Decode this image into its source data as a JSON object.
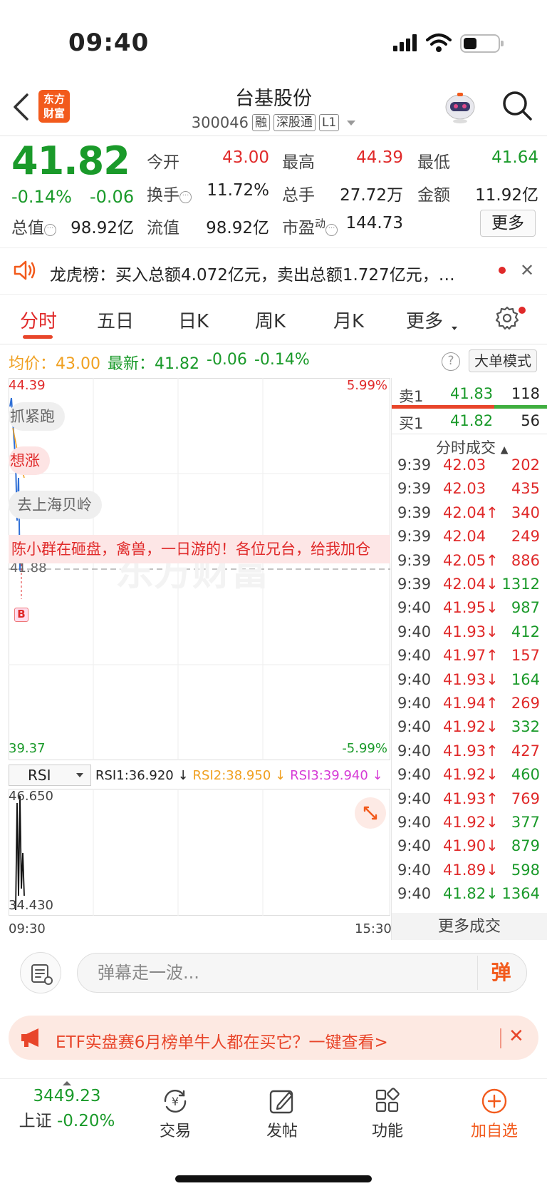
{
  "status_bar": {
    "time": "09:40"
  },
  "header": {
    "logo": "东方财富",
    "stock_name": "台基股份",
    "stock_code": "300046",
    "tags": [
      "融",
      "深股通",
      "L1"
    ]
  },
  "quote": {
    "price": "41.82",
    "change_pct": "-0.14%",
    "change": "-0.06",
    "fields": {
      "open_label": "今开",
      "open": "43.00",
      "high_label": "最高",
      "high": "44.39",
      "low_label": "最低",
      "low": "41.64",
      "turnover_label": "换手",
      "turnover": "11.72%",
      "volume_label": "总手",
      "volume": "27.72万",
      "amount_label": "金额",
      "amount": "11.92亿",
      "total_mv_label": "总值",
      "total_mv": "98.92亿",
      "float_mv_label": "流值",
      "float_mv": "98.92亿",
      "pe_label": "市盈",
      "pe_sup": "动",
      "pe": "144.73"
    },
    "more_label": "更多"
  },
  "notice": {
    "text": "龙虎榜：买入总额4.072亿元，卖出总额1.727亿元，…"
  },
  "tabs": [
    "分时",
    "五日",
    "日K",
    "周K",
    "月K",
    "更多"
  ],
  "avg_row": {
    "avg_label": "均价：",
    "avg": "43.00",
    "latest_label": "最新：",
    "latest": "41.82",
    "change": "-0.06",
    "change_pct": "-0.14%",
    "help": "?",
    "big_order_label": "大单模式"
  },
  "chart": {
    "y_max": "44.39",
    "y_min": "39.37",
    "pct_max": "5.99%",
    "pct_min": "-5.99%",
    "ref_price": "41.88",
    "x_start": "09:30",
    "x_end": "15:30",
    "marker": "B",
    "watermark": "东方财富",
    "danmu": [
      "抓紧跑",
      "想涨",
      "去上海贝岭",
      "陈小群在砸盘，禽兽，一日游的！各位兄台，给我加仓"
    ]
  },
  "rsi": {
    "selector": "RSI",
    "rsi1": "RSI1:36.920 ↓",
    "rsi2": "RSI2:38.950 ↓",
    "rsi3": "RSI3:39.940 ↓",
    "y_max": "46.650",
    "y_min": "34.430"
  },
  "order_book": {
    "sell1_label": "卖1",
    "sell1_price": "41.83",
    "sell1_vol": "118",
    "buy1_label": "买1",
    "buy1_price": "41.82",
    "buy1_vol": "56",
    "trades_title": "分时成交",
    "trades": [
      {
        "t": "9:39",
        "p": "42.03",
        "v": "202",
        "pc": "red",
        "vc": "red"
      },
      {
        "t": "9:39",
        "p": "42.03",
        "v": "435",
        "pc": "red",
        "vc": "red"
      },
      {
        "t": "9:39",
        "p": "42.04↑",
        "v": "340",
        "pc": "red",
        "vc": "red"
      },
      {
        "t": "9:39",
        "p": "42.04",
        "v": "249",
        "pc": "red",
        "vc": "red"
      },
      {
        "t": "9:39",
        "p": "42.05↑",
        "v": "886",
        "pc": "red",
        "vc": "red"
      },
      {
        "t": "9:39",
        "p": "42.04↓",
        "v": "1312",
        "pc": "red",
        "vc": "green"
      },
      {
        "t": "9:40",
        "p": "41.95↓",
        "v": "987",
        "pc": "red",
        "vc": "green"
      },
      {
        "t": "9:40",
        "p": "41.93↓",
        "v": "412",
        "pc": "red",
        "vc": "green"
      },
      {
        "t": "9:40",
        "p": "41.97↑",
        "v": "157",
        "pc": "red",
        "vc": "red"
      },
      {
        "t": "9:40",
        "p": "41.93↓",
        "v": "164",
        "pc": "red",
        "vc": "green"
      },
      {
        "t": "9:40",
        "p": "41.94↑",
        "v": "269",
        "pc": "red",
        "vc": "red"
      },
      {
        "t": "9:40",
        "p": "41.92↓",
        "v": "332",
        "pc": "red",
        "vc": "green"
      },
      {
        "t": "9:40",
        "p": "41.93↑",
        "v": "427",
        "pc": "red",
        "vc": "red"
      },
      {
        "t": "9:40",
        "p": "41.92↓",
        "v": "460",
        "pc": "red",
        "vc": "green"
      },
      {
        "t": "9:40",
        "p": "41.93↑",
        "v": "769",
        "pc": "red",
        "vc": "red"
      },
      {
        "t": "9:40",
        "p": "41.92↓",
        "v": "377",
        "pc": "red",
        "vc": "green"
      },
      {
        "t": "9:40",
        "p": "41.90↓",
        "v": "879",
        "pc": "red",
        "vc": "green"
      },
      {
        "t": "9:40",
        "p": "41.89↓",
        "v": "598",
        "pc": "red",
        "vc": "green"
      },
      {
        "t": "9:40",
        "p": "41.82↓",
        "v": "1364",
        "pc": "green",
        "vc": "green"
      }
    ],
    "more_trades_label": "更多成交"
  },
  "comment": {
    "placeholder": "弹幕走一波...",
    "danmu_button": "弹"
  },
  "promo": {
    "text": "ETF实盘赛6月榜单牛人都在买它？一键查看>"
  },
  "bottom_nav": {
    "index_value": "3449.23",
    "index_name": "上证",
    "index_change": "-0.20%",
    "items": [
      "交易",
      "发帖",
      "功能",
      "加自选"
    ]
  },
  "colors": {
    "up": "#e02a2a",
    "down": "#1a9a2a",
    "accent": "#f25a1c",
    "avg": "#f0a020"
  }
}
